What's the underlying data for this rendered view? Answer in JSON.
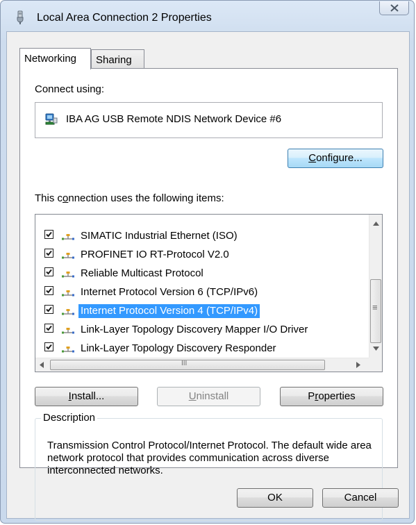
{
  "window": {
    "title": "Local Area Connection 2 Properties"
  },
  "tabs": [
    {
      "label": "Networking",
      "active": true
    },
    {
      "label": "Sharing",
      "active": false
    }
  ],
  "connect_using": {
    "label": "Connect using:",
    "device": "IBA AG USB Remote NDIS Network Device #6",
    "configure_pre": "",
    "configure_key": "C",
    "configure_post": "onfigure..."
  },
  "items_label": {
    "pre": "This c",
    "key": "o",
    "post": "nnection uses the following items:"
  },
  "items": [
    {
      "label": "SIMATIC Industrial Ethernet (ISO)",
      "checked": true,
      "selected": false
    },
    {
      "label": "PROFINET IO RT-Protocol V2.0",
      "checked": true,
      "selected": false
    },
    {
      "label": "Reliable Multicast Protocol",
      "checked": true,
      "selected": false
    },
    {
      "label": "Internet Protocol Version 6 (TCP/IPv6)",
      "checked": true,
      "selected": false
    },
    {
      "label": "Internet Protocol Version 4 (TCP/IPv4)",
      "checked": true,
      "selected": true
    },
    {
      "label": "Link-Layer Topology Discovery Mapper I/O Driver",
      "checked": true,
      "selected": false
    },
    {
      "label": "Link-Layer Topology Discovery Responder",
      "checked": true,
      "selected": false
    }
  ],
  "buttons": {
    "install_key": "I",
    "install_post": "nstall...",
    "uninstall_key": "U",
    "uninstall_post": "ninstall",
    "properties_pre": "P",
    "properties_key": "r",
    "properties_post": "operties",
    "ok": "OK",
    "cancel": "Cancel"
  },
  "description": {
    "legend": "Description",
    "text": "Transmission Control Protocol/Internet Protocol. The default wide area network protocol that provides communication across diverse interconnected networks."
  },
  "scroll": {
    "h_thumb_grip": "III",
    "v_thumb_grip": "≡"
  },
  "colors": {
    "selection": "#3399ff",
    "focus_border": "#3c7fb1"
  }
}
